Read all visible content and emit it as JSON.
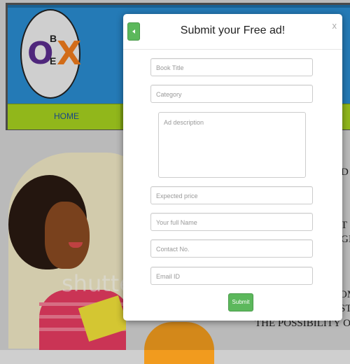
{
  "site": {
    "logo": {
      "o": "O",
      "b": "B",
      "e": "E",
      "x": "X"
    },
    "nav": {
      "home": "HOME"
    },
    "watermark": "shutte",
    "bg_text": [
      "D",
      "T",
      "GI",
      "OM",
      "ST",
      "THE POSSIBILITY OF A"
    ]
  },
  "modal": {
    "title": "Submit your Free ad!",
    "close_label": "x",
    "placeholders": {
      "book_title": "Book Title",
      "category": "Category",
      "ad_description": "Ad description",
      "expected_price": "Expected price",
      "full_name": "Your full Name",
      "contact_no": "Contact No.",
      "email": "Email ID"
    },
    "submit_label": "Submit"
  },
  "colors": {
    "header_blue": "#2a8bd0",
    "nav_green": "#a6d11f",
    "button_green": "#5cb85c",
    "logo_purple": "#5b2d8e",
    "logo_orange": "#f07b1c"
  }
}
